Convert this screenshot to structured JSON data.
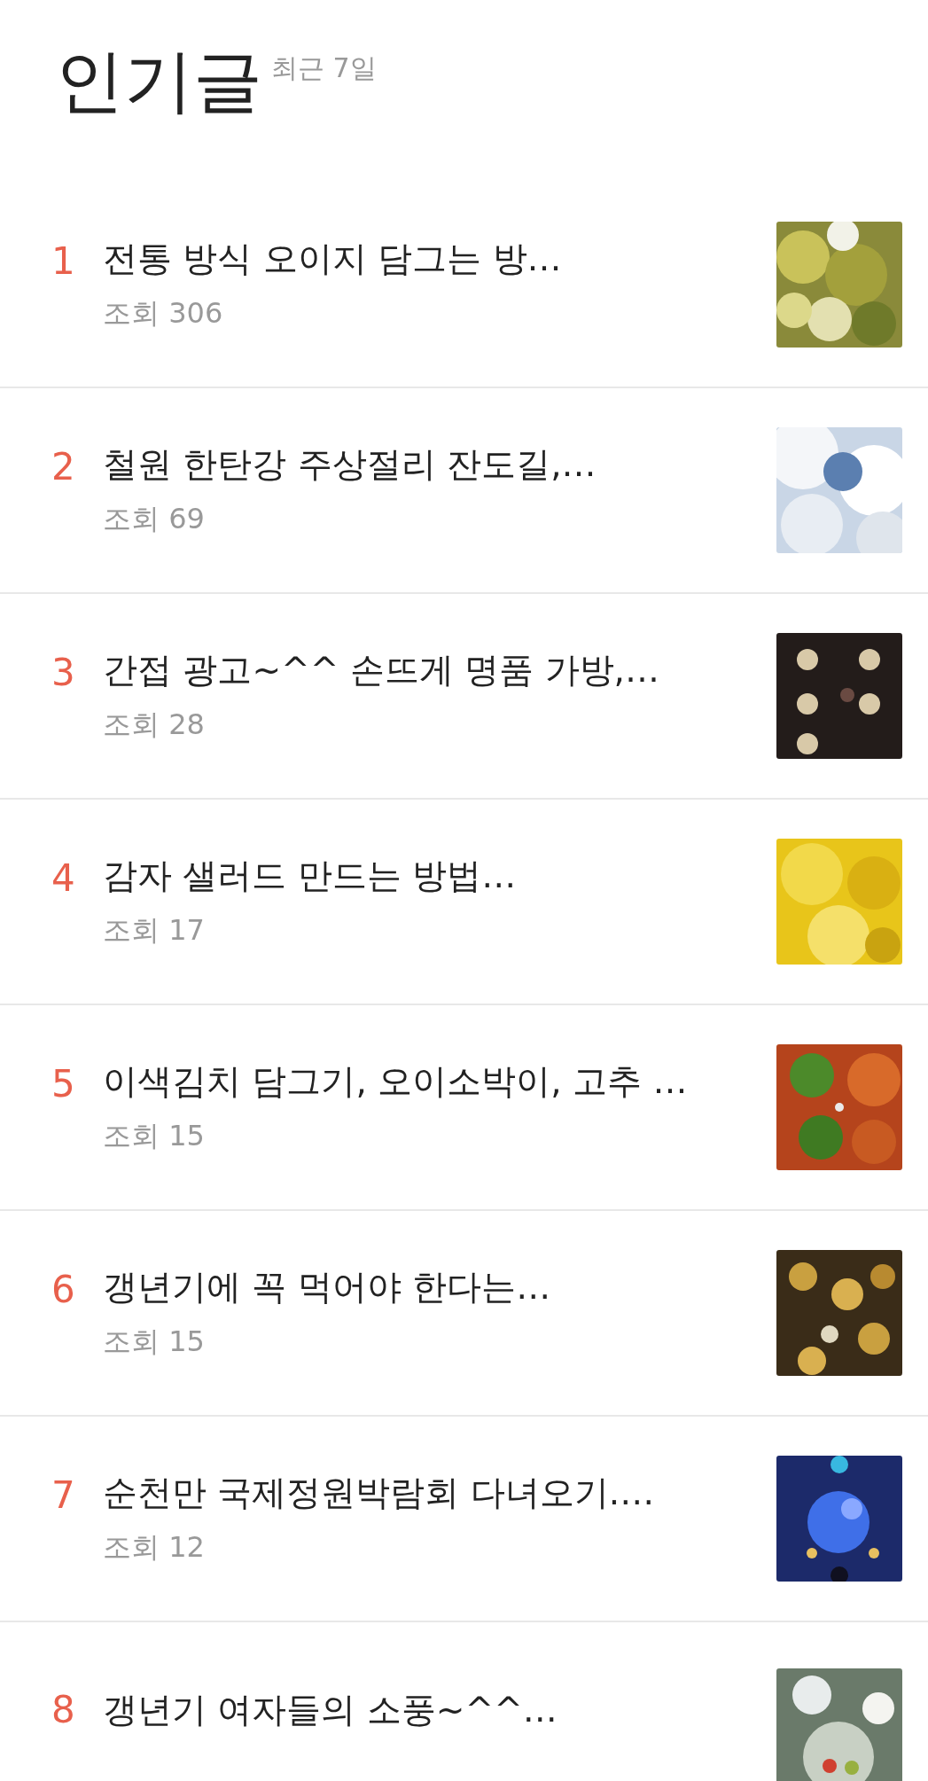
{
  "header": {
    "title": "인기글",
    "period": "최근 7일"
  },
  "posts": [
    {
      "rank": "1",
      "title": "전통 방식 오이지 담그는 방…",
      "views": "조회 306"
    },
    {
      "rank": "2",
      "title": "철원 한탄강 주상절리 잔도길,…",
      "views": "조회 69"
    },
    {
      "rank": "3",
      "title": "간접 광고~^^  손뜨게 명품 가방,…",
      "views": "조회 28"
    },
    {
      "rank": "4",
      "title": "감자 샐러드 만드는 방법…",
      "views": "조회 17"
    },
    {
      "rank": "5",
      "title": "이색김치 담그기, 오이소박이, 고추 …",
      "views": "조회 15"
    },
    {
      "rank": "6",
      "title": "갱년기에 꼭 먹어야 한다는…",
      "views": "조회 15"
    },
    {
      "rank": "7",
      "title": "순천만 국제정원박람회 다녀오기.…",
      "views": "조회 12"
    },
    {
      "rank": "8",
      "title": "갱년기 여자들의 소풍~^^…"
    }
  ]
}
